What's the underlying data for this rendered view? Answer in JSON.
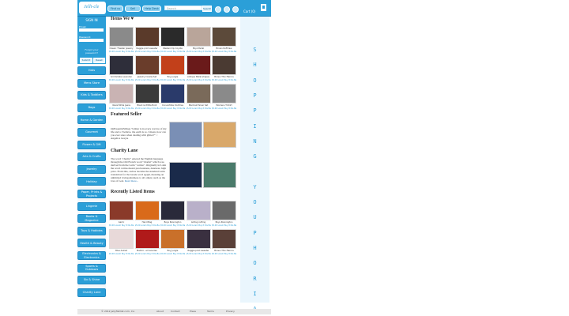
{
  "header": {
    "logo_text": "Jelli-cle",
    "nav_pills": [
      "Find us",
      "Sell",
      "Help Desk"
    ],
    "search_placeholder": "Search",
    "search_button": "Search",
    "cart_label": "Cart (0)",
    "social_icons": [
      "facebook-icon",
      "twitter-icon",
      "rss-icon"
    ]
  },
  "sidebar": {
    "login": {
      "title": "SIGN IN",
      "email_label": "Email:",
      "password_label": "Password:",
      "forgot": "Forgot your password?",
      "submit": "Submit",
      "reset": "Reset"
    },
    "nav": [
      "Hats",
      "Mens Store",
      "Kids & Toddlers",
      "Bags",
      "Home & Garden",
      "Gourmet",
      "Flower & Gift",
      "Arts & Crafts",
      "Jewelry",
      "Holiday",
      "Paper, Prints & Projects",
      "Lingerie",
      "Books & Magazine",
      "Toys & Hobbies",
      "Health & Beauty",
      "Electronics & Electronics",
      "Sports & Outdoors",
      "Six & Shine",
      "Charity Lane"
    ]
  },
  "main": {
    "items_title": "Items We ♥",
    "items": [
      {
        "caption": "Classic Theater Jewelry",
        "meta": "$5.00 Lorem  Buy It  Dis Baged",
        "color": "#8a8a8a"
      },
      {
        "caption": "Raggie print sweater",
        "meta": "$5.00 Lorem  Buy It  Dis Baged",
        "color": "#5a3a2a"
      },
      {
        "caption": "Western tip Coyote",
        "meta": "$5.00 Lorem  Buy It  Dis Baged",
        "color": "#2a2a2a"
      },
      {
        "caption": "Boyz Pedal",
        "meta": "$5.00 Lorem  Buy It  Dis Baged",
        "color": "#b9a59a"
      },
      {
        "caption": "Brown Ruffclaw",
        "meta": "$5.00 Lorem  Buy It  Dis Baged",
        "color": "#5c4a3a"
      },
      {
        "caption": "Scrimmate Lavender",
        "meta": "$5.00 Lorem  Buy It  Dis Baged",
        "color": "#2e2e3a"
      },
      {
        "caption": "Jewelry Coralia Set",
        "meta": "$5.00 Lorem  Buy It  Dis Baged",
        "color": "#6a3d2b"
      },
      {
        "caption": "Boy Jungle",
        "meta": "$5.00 Lorem  Buy It  Dis Baged",
        "color": "#c2401a"
      },
      {
        "caption": "Antique Metal shapes",
        "meta": "$5.00 Lorem  Buy It  Dis Baged",
        "color": "#6a1a1a"
      },
      {
        "caption": "Brown Thin Fabrics",
        "meta": "$5.00 Lorem  Buy It  Dis Baged",
        "color": "#4a3a32"
      },
      {
        "caption": "Velvet Wide Jeans",
        "meta": "$5.00 Lorem  Buy It  Dis Baged",
        "color": "#c9b3b3"
      },
      {
        "caption": "Black & White Boot",
        "meta": "$5.00 Lorem  Buy It  Dis Baged",
        "color": "#3a3a3a"
      },
      {
        "caption": "Convertible Clutches",
        "meta": "$5.00 Lorem  Buy It  Dis Baged",
        "color": "#2a3a6a"
      },
      {
        "caption": "Mermaid Silver Set",
        "meta": "$5.00 Lorem  Buy It  Dis Baged",
        "color": "#7a6a5a"
      },
      {
        "caption": "Womens T-Shirt",
        "meta": "$5.00 Lorem  Buy It  Dis Baged",
        "color": "#8a8a8a"
      }
    ],
    "featured_title": "Featured Seller",
    "featured_text": "OnEssentialWings \"Glitter is in every crevice of my life and a J believe, the earth is so. I mean, how can you ever stare when dealing with glitter?\" ~ Angelica Greyte",
    "featured_colors": [
      "#7a8fb5",
      "#d9a86a"
    ],
    "charity_title": "Charity Lane",
    "charity_text": "The word \"charity\" entered the English language through the Old French word \"charité\" which was derived from the Latin \"caritas\". Originally in Latin the word caritas meant preciousness, dearness, high price. From this, caritas became the standard Latin translation for the Greek word agapē, meaning an unlimited loving-kindness to all others; such as the love of God.",
    "charity_link": "Read more...",
    "charity_colors": [
      "#1a2a4a",
      "#4a7a6a"
    ],
    "recent_title": "Recently Listed Items",
    "recent": [
      {
        "caption": "Garlic",
        "meta": "$5.00 Lorem  Buy It  Dis Baged",
        "color": "#8a3a2a"
      },
      {
        "caption": "Hand Bag",
        "meta": "$5.00 Lorem  Buy It  Dis Baged",
        "color": "#d96a1a"
      },
      {
        "caption": "Boys Pennington",
        "meta": "$5.00 Lorem  Buy It  Dis Baged",
        "color": "#2a2a3a"
      },
      {
        "caption": "Antlog cutting",
        "meta": "$5.00 Lorem  Buy It  Dis Baged",
        "color": "#b9b0c9"
      },
      {
        "caption": "Boys Pennington",
        "meta": "$5.00 Lorem  Buy It  Dis Baged",
        "color": "#6a6a6a"
      },
      {
        "caption": "Blue Anklet",
        "meta": "$5.00 Lorem  Buy It  Dis Baged",
        "color": "#e8d9d9"
      },
      {
        "caption": "Matchl - art wooden",
        "meta": "$5.00 Lorem  Buy It  Dis Baged",
        "color": "#b01a1a"
      },
      {
        "caption": "Boy Jungle",
        "meta": "$5.00 Lorem  Buy It  Dis Baged",
        "color": "#c9702a"
      },
      {
        "caption": "Raggie print sweater",
        "meta": "$5.00 Lorem  Buy It  Dis Baged",
        "color": "#3a3040"
      },
      {
        "caption": "Brown Thin Fabrics",
        "meta": "$5.00 Lorem  Buy It  Dis Baged",
        "color": "#5a4038"
      }
    ]
  },
  "banner": {
    "letters": [
      "S",
      "H",
      "O",
      "P",
      "P",
      "I",
      "N",
      "G",
      " ",
      "Y",
      "O",
      "U",
      "P",
      "H",
      "O",
      "R",
      "I",
      "A"
    ]
  },
  "footer": {
    "copyright": "© 2012 Jellyfishlist.com, Inc.",
    "links": [
      "About",
      "Contact",
      "Press",
      "Terms",
      "Privacy"
    ]
  },
  "colors": {
    "brand": "#2b9fd8",
    "banner_bg": "#eaf6fd"
  }
}
